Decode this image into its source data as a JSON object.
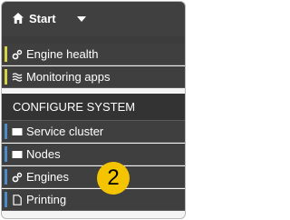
{
  "header": {
    "title": "Start",
    "home_icon": "home-icon",
    "menu_icon": "chevron-down-icon"
  },
  "nav": {
    "items_top": [
      {
        "label": "Engine health",
        "icon": "gears-icon",
        "accent": "#d6d243"
      },
      {
        "label": "Monitoring apps",
        "icon": "waves-icon",
        "accent": "#d6d243"
      }
    ],
    "section_title": "CONFIGURE SYSTEM",
    "items_configure": [
      {
        "label": "Service cluster",
        "icon": "block-icon",
        "accent": "#4d8cc9"
      },
      {
        "label": "Nodes",
        "icon": "block-icon",
        "accent": "#4d8cc9"
      },
      {
        "label": "Engines",
        "icon": "gears-icon",
        "accent": "#4d8cc9"
      },
      {
        "label": "Printing",
        "icon": "document-icon",
        "accent": "#4d8cc9"
      }
    ]
  },
  "badge": {
    "text": "2",
    "color": "#f4c400"
  }
}
